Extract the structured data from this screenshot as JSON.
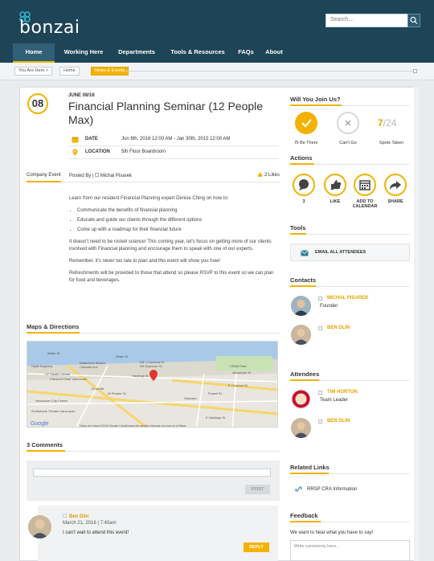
{
  "header": {
    "logo_text": "bonzai",
    "search_placeholder": "Search..."
  },
  "nav": [
    {
      "label": "Home",
      "active": true
    },
    {
      "label": "Working Here"
    },
    {
      "label": "Departments"
    },
    {
      "label": "Tools & Resources"
    },
    {
      "label": "FAQs"
    },
    {
      "label": "About"
    }
  ],
  "breadcrumb": [
    "You Are Here >",
    "Home",
    "News & Events"
  ],
  "event": {
    "day": "08",
    "date_small": "JUNE 08/16",
    "title": "Financial Planning Seminar (12 People Max)",
    "date_label": "DATE",
    "date_value": "Jun 8th, 2016 12:00 AM - Jan 30th, 2015 12:00 AM",
    "location_label": "LOCATION",
    "location_value": "5th Floor Boardroom",
    "category": "Company Event",
    "posted_by": "Posted By |",
    "author": "Michal Pisarek",
    "likes": "2 Likes",
    "intro": "Learn from our resident Financial Planning expert Denise Ching on how to:",
    "bullets": [
      "Communicate the benefits of financial planning",
      "Educate and guide our clients through the different options",
      "Come up with a roadmap for their financial future"
    ],
    "para1": "It doesn't need to be rocket science!  This coming year, let's focus on getting more of our clients involved with Financial planning and encourage them to speak with one of our experts.",
    "para2": "Remember, it's never too late to plan and this event will show you how!",
    "para3": "Refreshments will be provided to those that attend so please RSVP to this event so we can plan for food and beverages."
  },
  "map_section": {
    "title": "Maps & Directions",
    "labels": [
      "Water St",
      "Waterfront Station",
      "Canada Line",
      "EB > Cordova St",
      "NS Seymour St",
      "Hastings St",
      "CRAB Park",
      "Powell St",
      "Alexander St",
      "Gastown",
      "E Cordova St",
      "E Hastings St",
      "W Pender St",
      "Granville",
      "Vancouver City Centre",
      "Fairmont Hotel Vancouver",
      "Scotiabank Theatre Vancouver",
      "Hyatt Regency",
      "CF Pacific Centre",
      "Water St",
      "Google"
    ],
    "footer": "Datos del mapa ©2016 Google   Condiciones del servicio   Informar un error en el Mapa"
  },
  "comments": {
    "title": "3 Comments",
    "post_label": "POST",
    "items": [
      {
        "name": "Ben Dlin",
        "date": "March 21, 2016 | 7:40am",
        "text": "I can't wait to attend this event!",
        "reply": "REPLY"
      }
    ]
  },
  "rsvp": {
    "title": "Will You Join Us?",
    "going": "I'll Be There",
    "not_going": "Can't Go",
    "spots_taken": "7",
    "spots_total": "/24",
    "spots_label": "Spots Taken"
  },
  "actions": {
    "title": "Actions",
    "items": [
      {
        "count": "3",
        "label": "3"
      },
      {
        "label": "LIKE"
      },
      {
        "label": "ADD TO CALENDAR"
      },
      {
        "label": "SHARE"
      }
    ]
  },
  "tools": {
    "title": "Tools",
    "email_all": "EMAIL ALL ATTENDEES"
  },
  "contacts": {
    "title": "Contacts",
    "people": [
      {
        "name": "MICHAL PISAREK",
        "role": "Founder"
      },
      {
        "name": "BEN DLIN",
        "role": ""
      }
    ]
  },
  "attendees": {
    "title": "Attendees",
    "people": [
      {
        "name": "TIM HORTON",
        "role": "Team Leader"
      },
      {
        "name": "BEN DLIN",
        "role": ""
      }
    ]
  },
  "related": {
    "title": "Related Links",
    "link": "RRSP CRA Information"
  },
  "feedback": {
    "title": "Feedback",
    "prompt": "We want to hear what you have to say!",
    "placeholder": "Write comments here..."
  },
  "colors": {
    "accent": "#f3b200",
    "header": "#1d4457",
    "nav_active": "#315f76"
  }
}
